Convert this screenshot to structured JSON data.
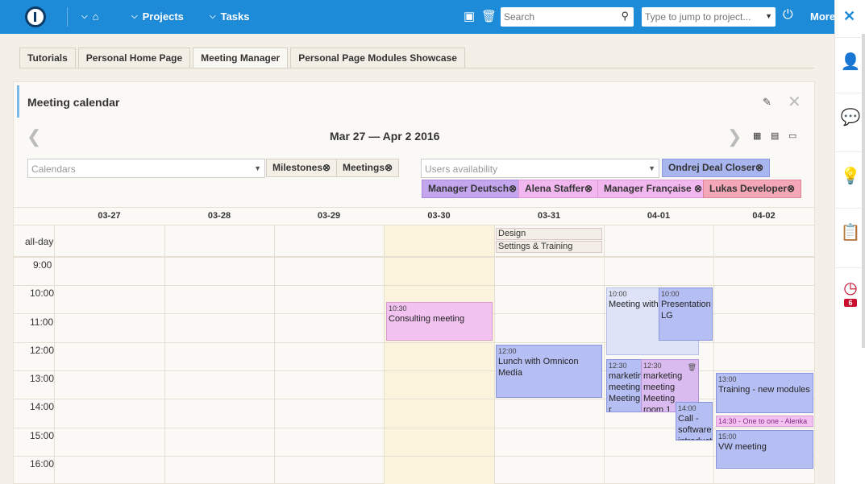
{
  "topbar": {
    "home_icon": "home-icon",
    "projects_label": "Projects",
    "tasks_label": "Tasks",
    "search_placeholder": "Search",
    "jump_placeholder": "Type to jump to project...",
    "more_label": "More"
  },
  "rail": {
    "badge_count": "6"
  },
  "tabs": [
    {
      "label": "Tutorials"
    },
    {
      "label": "Personal Home Page"
    },
    {
      "label": "Meeting Manager"
    },
    {
      "label": "Personal Page Modules Showcase"
    }
  ],
  "panel": {
    "title": "Meeting calendar",
    "range": "Mar 27 — Apr 2 2016",
    "calendars_placeholder": "Calendars",
    "users_placeholder": "Users availability",
    "calendar_chips": [
      "Milestones⊗",
      "Meetings⊗"
    ],
    "user_chips": [
      "Ondrej Deal Closer⊗",
      "Manager Deutsch⊗",
      "Alena Staffer⊗",
      "Manager Française ⊗",
      "Lukas Developer⊗"
    ]
  },
  "calendar": {
    "days": [
      "03-27",
      "03-28",
      "03-29",
      "03-30",
      "03-31",
      "04-01",
      "04-02"
    ],
    "allday_label": "all-day",
    "hours": [
      "9:00",
      "10:00",
      "11:00",
      "12:00",
      "13:00",
      "14:00",
      "15:00",
      "16:00"
    ],
    "allday_events": [
      {
        "title": "Design"
      },
      {
        "title": "Settings & Training"
      }
    ],
    "events": [
      {
        "time": "10:30",
        "title": "Consulting meeting"
      },
      {
        "time": "12:00",
        "title": "Lunch with Omnicon Media"
      },
      {
        "time": "10:00",
        "title": "Meeting with p"
      },
      {
        "time": "10:00",
        "title": "Presentation LG"
      },
      {
        "time": "12:30",
        "title": "marketing meeting Meeting r"
      },
      {
        "time": "12:30",
        "title": "marketing meeting Meeting room 1"
      },
      {
        "time": "14:00",
        "title": "Call - software introducti"
      },
      {
        "time": "13:00",
        "title": "Training - new modules"
      },
      {
        "time": "",
        "title": "14:30 - One to one - Alenka"
      },
      {
        "time": "15:00",
        "title": "VW meeting"
      }
    ]
  }
}
